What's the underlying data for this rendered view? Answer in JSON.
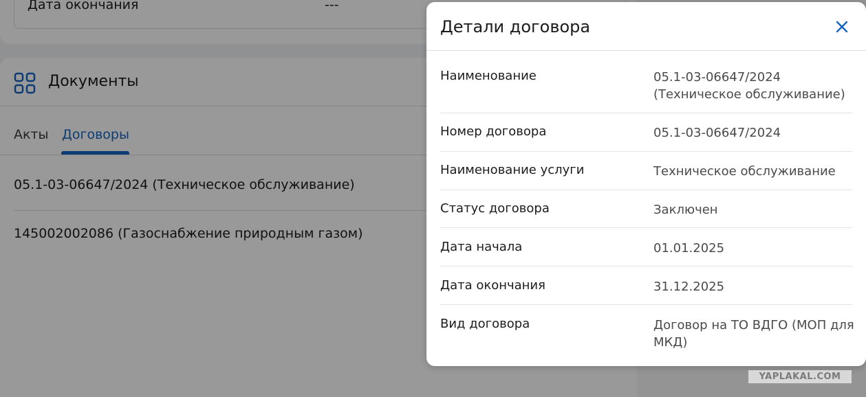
{
  "background": {
    "top_row": {
      "label": "Дата окончания",
      "value": "---"
    },
    "documents": {
      "title": "Документы",
      "icon": "grid-icon",
      "tabs": [
        {
          "label": "Акты",
          "active": false
        },
        {
          "label": "Договоры",
          "active": true
        }
      ],
      "items": [
        "05.1-03-06647/2024 (Техническое обслуживание)",
        "145002002086 (Газоснабжение природным газом)"
      ]
    }
  },
  "modal": {
    "title": "Детали договора",
    "close_icon": "close-icon",
    "rows": [
      {
        "label": "Наименование",
        "value": "05.1-03-06647/2024 (Техническое обслуживание)"
      },
      {
        "label": "Номер договора",
        "value": "05.1-03-06647/2024"
      },
      {
        "label": "Наименование услуги",
        "value": "Техническое обслуживание"
      },
      {
        "label": "Статус договора",
        "value": "Заключен"
      },
      {
        "label": "Дата начала",
        "value": "01.01.2025"
      },
      {
        "label": "Дата окончания",
        "value": "31.12.2025"
      },
      {
        "label": "Вид договора",
        "value": "Договор на ТО ВДГО (МОП для МКД)"
      }
    ]
  },
  "watermark": "YAPLAKAL.COM",
  "colors": {
    "accent": "#1565c0",
    "overlay": "rgba(0,0,0,0.4)"
  }
}
